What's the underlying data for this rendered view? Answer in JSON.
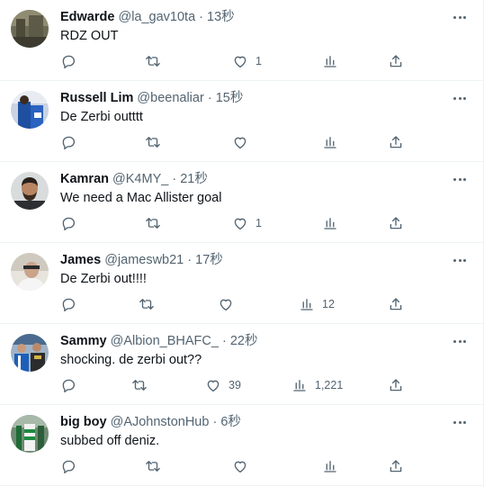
{
  "icons": {
    "more": "more-dots-icon",
    "reply": "reply-icon",
    "retweet": "retweet-icon",
    "like": "heart-icon",
    "views": "views-bar-chart-icon",
    "share": "share-upload-icon"
  },
  "tweets": [
    {
      "name": "Edwarde",
      "handle": "@la_gav10ta",
      "sep": "·",
      "time": "13秒",
      "text": "RDZ OUT",
      "likes": "1",
      "views": ""
    },
    {
      "name": "Russell Lim",
      "handle": "@beenaliar",
      "sep": "·",
      "time": "15秒",
      "text": "De Zerbi outttt",
      "likes": "",
      "views": ""
    },
    {
      "name": "Kamran",
      "handle": "@K4MY_",
      "sep": "·",
      "time": "21秒",
      "text": "We need a Mac Allister goal",
      "likes": "1",
      "views": ""
    },
    {
      "name": "James",
      "handle": "@jameswb21",
      "sep": "·",
      "time": "17秒",
      "text": "De Zerbi out!!!!",
      "likes": "",
      "views": "12"
    },
    {
      "name": "Sammy",
      "handle": "@Albion_BHAFC_",
      "sep": "·",
      "time": "22秒",
      "text": "shocking. de zerbi out??",
      "likes": "39",
      "views": "1,221"
    },
    {
      "name": "big boy",
      "handle": "@AJohnstonHub",
      "sep": "·",
      "time": "6秒",
      "text": "subbed off deniz.",
      "likes": "",
      "views": ""
    }
  ]
}
